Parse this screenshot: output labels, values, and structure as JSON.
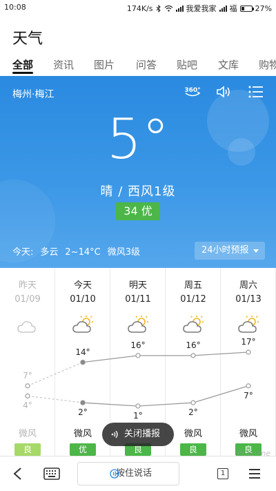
{
  "status_bar": {
    "time": "10:08",
    "speed": "174K/s",
    "carrier1": "我爱我家",
    "carrier2": "福",
    "battery": "27%",
    "battery_level": 0.27
  },
  "app_title": "天气",
  "tabs": [
    {
      "label": "全部",
      "active": true
    },
    {
      "label": "资讯"
    },
    {
      "label": "图片"
    },
    {
      "label": "问答"
    },
    {
      "label": "贴吧"
    },
    {
      "label": "文库"
    },
    {
      "label": "购物"
    }
  ],
  "hero": {
    "location": "梅州·梅江",
    "icons": [
      "360-view-icon",
      "speaker-icon",
      "menu-icon"
    ],
    "temperature": "5°",
    "condition": "晴 / 西风1级",
    "aqi": "34 优",
    "aqi_color": "#4cb648",
    "today_label": "今天:",
    "today_weather": "多云",
    "today_range": "2~14°C",
    "today_wind": "微风3级",
    "forecast_button": "24小时预报"
  },
  "forecast": [
    {
      "day": "昨天",
      "date": "01/09",
      "icon": "cloud-icon",
      "high": "7°",
      "low": "4°",
      "high_val": 7,
      "low_val": 4,
      "wind": "微风",
      "aq": "良",
      "aq_color": "#a6d968",
      "past": true
    },
    {
      "day": "今天",
      "date": "01/10",
      "icon": "partly-cloudy-icon",
      "high": "14°",
      "low": "2°",
      "high_val": 14,
      "low_val": 2,
      "wind": "微风",
      "aq": "优",
      "aq_color": "#4cb648",
      "past": false
    },
    {
      "day": "明天",
      "date": "01/11",
      "icon": "partly-cloudy-icon",
      "high": "16°",
      "low": "1°",
      "high_val": 16,
      "low_val": 1,
      "wind": "微风",
      "aq": "良",
      "aq_color": "#4cb648",
      "past": false
    },
    {
      "day": "周五",
      "date": "01/12",
      "icon": "partly-cloudy-icon",
      "high": "16°",
      "low": "2°",
      "high_val": 16,
      "low_val": 2,
      "wind": "微风",
      "aq": "良",
      "aq_color": "#4cb648",
      "past": false
    },
    {
      "day": "周六",
      "date": "01/13",
      "icon": "partly-cloudy-icon",
      "high": "17°",
      "low": "7°",
      "high_val": 17,
      "low_val": 7,
      "wind": "微风",
      "aq": "良",
      "aq_color": "#4cb648",
      "past": false
    }
  ],
  "toast": "关闭播报",
  "bottom_bar": {
    "voice_label": "按住说话",
    "tab_count": "1"
  },
  "watermark": "PConline"
}
